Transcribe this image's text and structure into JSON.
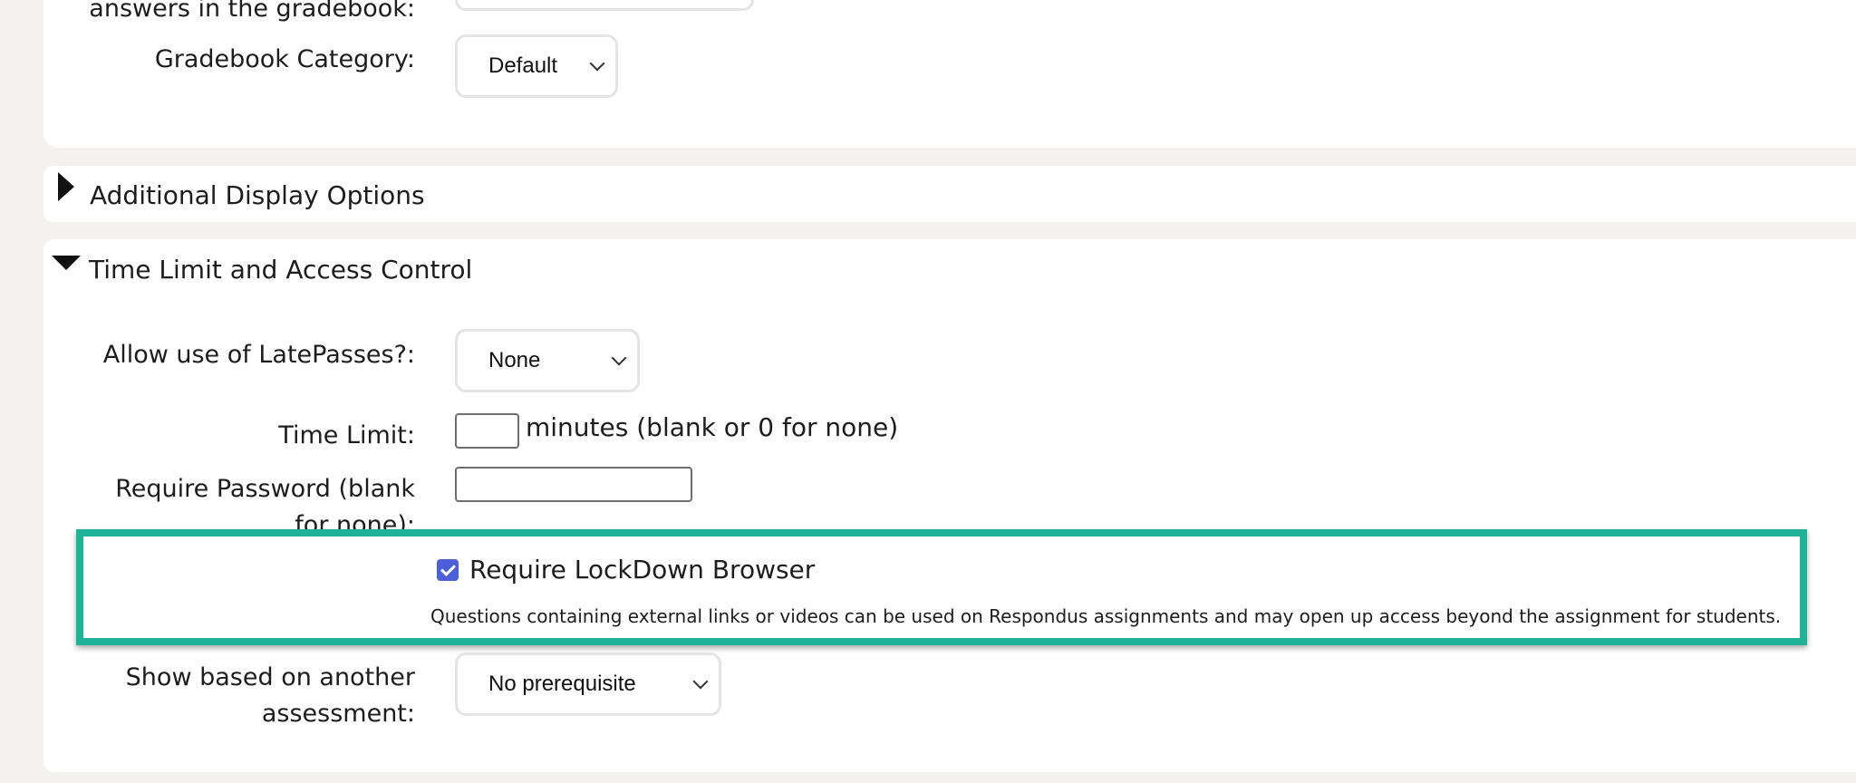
{
  "gradebook": {
    "answers_label_partial": "answers in the gradebook:",
    "category_label": "Gradebook Category:",
    "category_value": "Default"
  },
  "sections": {
    "additional_display": "Additional Display Options",
    "time_limit_access": "Time Limit and Access Control"
  },
  "time_access": {
    "latepasses_label": "Allow use of LatePasses?:",
    "latepasses_value": "None",
    "time_limit_label": "Time Limit:",
    "time_limit_value": "",
    "time_limit_suffix": "minutes (blank or 0 for none)",
    "password_label_line1": "Require Password (blank",
    "password_label_line2": "for none):",
    "password_value": "",
    "lockdown_label": "Require LockDown Browser",
    "lockdown_checked": true,
    "lockdown_note": "Questions containing external links or videos can be used on Respondus assignments and may open up access beyond the assignment for students.",
    "show_based_label_line1": "Show based on another",
    "show_based_label_line2": "assessment:",
    "show_based_value": "No prerequisite"
  },
  "colors": {
    "highlight_border": "#20b39a",
    "checkbox": "#4d5fd8",
    "page_bg": "#f3f2ef"
  },
  "icons": {
    "collapsed": "triangle-right-icon",
    "expanded": "triangle-down-icon",
    "dropdown": "chevron-down-icon"
  }
}
